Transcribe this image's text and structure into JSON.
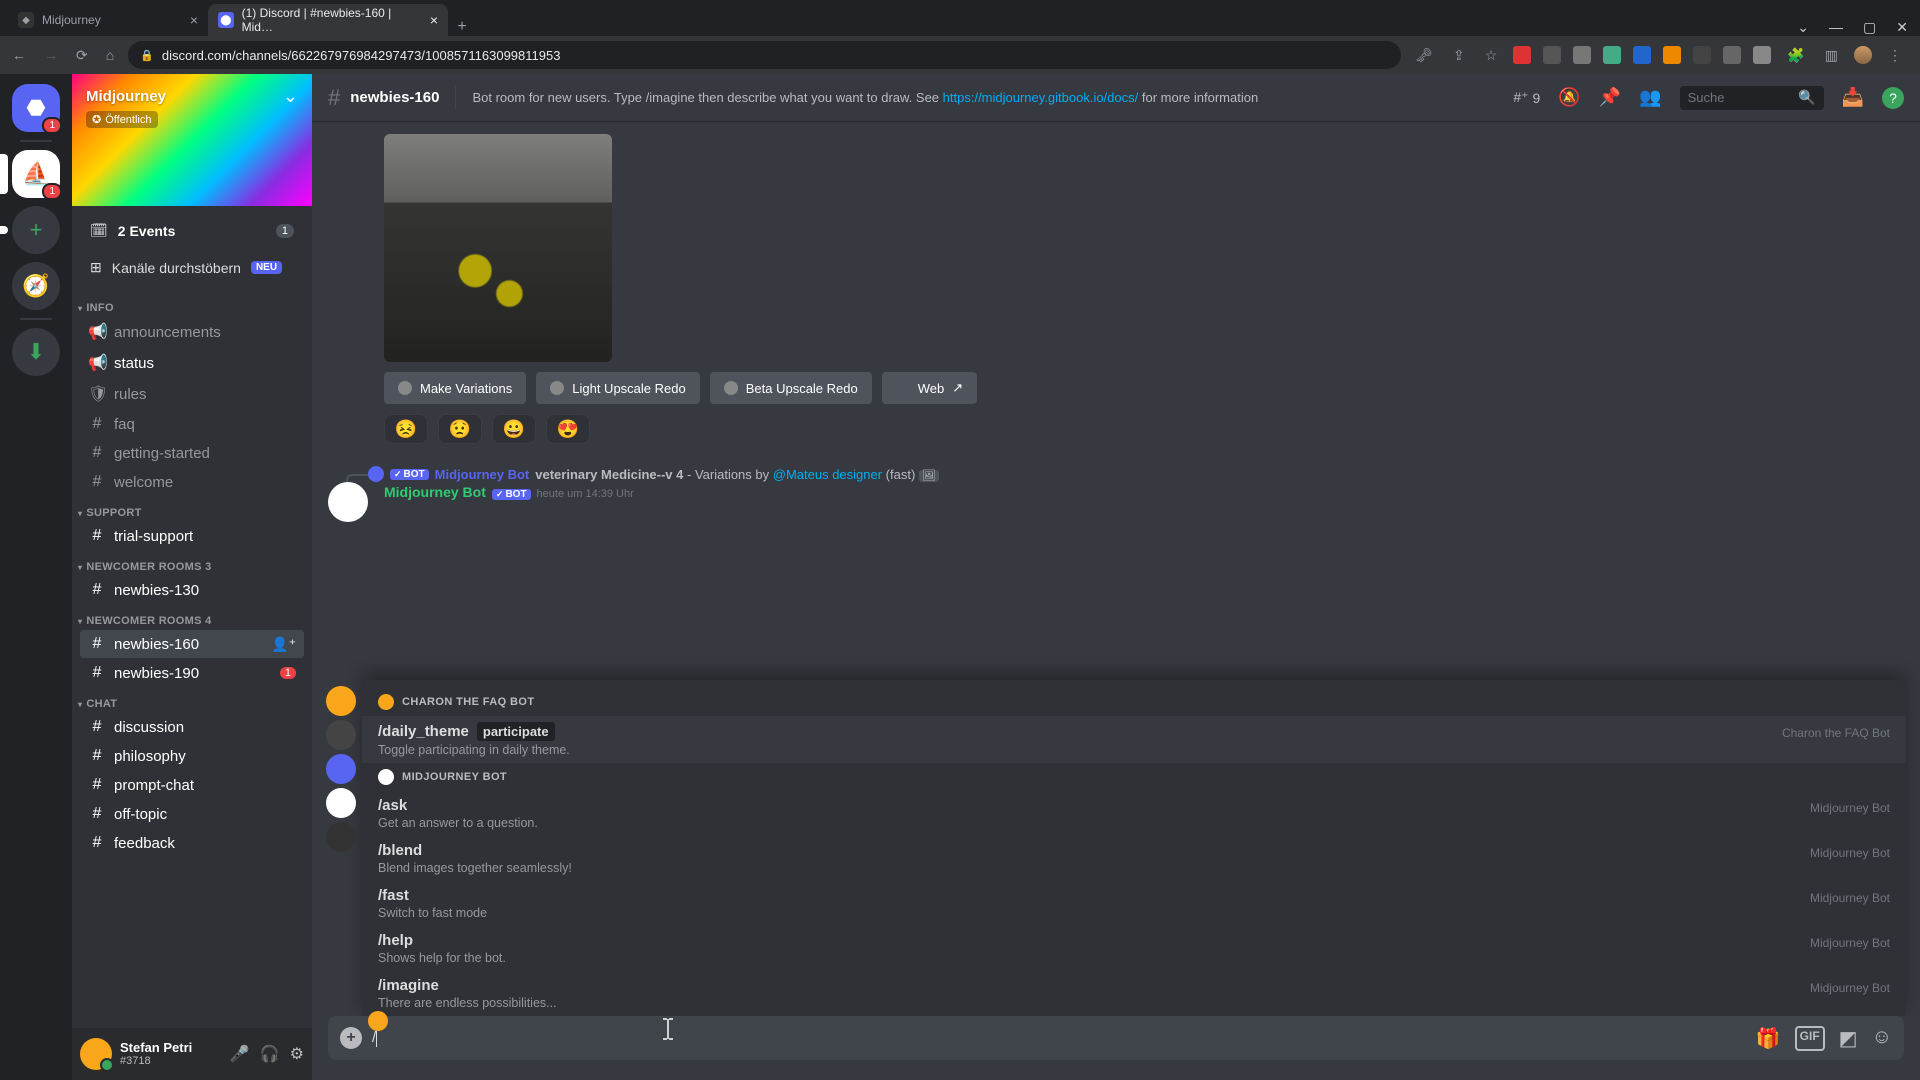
{
  "browser": {
    "tabs": [
      {
        "favicon": "M",
        "title": "Midjourney",
        "active": false
      },
      {
        "favicon": "D",
        "title": "(1) Discord | #newbies-160 | Mid…",
        "active": true
      }
    ],
    "url": "discord.com/channels/662267976984297473/1008571163099811953"
  },
  "server_rail": {
    "home_tooltip": "Home",
    "selected_server": "Midjourney",
    "add_label": "+",
    "discover_label": "🧭",
    "download_label": "⬇"
  },
  "sidebar": {
    "server_name": "Midjourney",
    "public_badge": "Öffentlich",
    "chevron": "⌄",
    "events_label": "2 Events",
    "events_count": "1",
    "browse_label": "Kanäle durchstöbern",
    "neu_badge": "NEU",
    "categories": [
      {
        "name": "INFO",
        "channels": [
          {
            "icon": "📢",
            "label": "announcements",
            "unread": false
          },
          {
            "icon": "📢",
            "label": "status",
            "unread": true
          },
          {
            "icon": "🛡",
            "label": "rules",
            "unread": false
          },
          {
            "icon": "#",
            "label": "faq",
            "unread": false
          },
          {
            "icon": "#",
            "label": "getting-started",
            "unread": false
          },
          {
            "icon": "#",
            "label": "welcome",
            "unread": false
          }
        ]
      },
      {
        "name": "SUPPORT",
        "channels": [
          {
            "icon": "#",
            "label": "trial-support",
            "unread": true
          }
        ]
      },
      {
        "name": "NEWCOMER ROOMS 3",
        "channels": [
          {
            "icon": "#",
            "label": "newbies-130",
            "unread": true
          }
        ]
      },
      {
        "name": "NEWCOMER ROOMS 4",
        "channels": [
          {
            "icon": "#",
            "label": "newbies-160",
            "unread": true,
            "selected": true,
            "invite": true
          },
          {
            "icon": "#",
            "label": "newbies-190",
            "unread": true,
            "badge": "1"
          }
        ]
      },
      {
        "name": "CHAT",
        "channels": [
          {
            "icon": "#",
            "label": "discussion",
            "unread": true
          },
          {
            "icon": "#",
            "label": "philosophy",
            "unread": true
          },
          {
            "icon": "#",
            "label": "prompt-chat",
            "unread": true
          },
          {
            "icon": "#",
            "label": "off-topic",
            "unread": true
          },
          {
            "icon": "#",
            "label": "feedback",
            "unread": true
          }
        ]
      }
    ]
  },
  "user_panel": {
    "name": "Stefan Petri",
    "tag": "#3718"
  },
  "chat": {
    "channel_name": "newbies-160",
    "topic_pre": "Bot room for new users. Type /imagine then describe what you want to draw. See ",
    "topic_link": "https://midjourney.gitbook.io/docs/",
    "topic_post": " for more information",
    "threads_count": "9",
    "search_placeholder": "Suche"
  },
  "message": {
    "action_buttons": [
      {
        "label": "Make Variations"
      },
      {
        "label": "Light Upscale Redo"
      },
      {
        "label": "Beta Upscale Redo"
      },
      {
        "label": "Web",
        "external": true
      }
    ],
    "reactions": [
      "😣",
      "😟",
      "😀",
      "😍"
    ]
  },
  "reply_preview": {
    "author": "Midjourney Bot",
    "bot_tag": "BOT",
    "content_strong": "veterinary Medicine--v 4",
    "content_mid": " - Variations by ",
    "mention": "@Mateus designer",
    "content_post": " (fast)"
  },
  "new_message_header": {
    "author": "Midjourney Bot",
    "bot_tag": "BOT",
    "timestamp": "heute um 14:39 Uhr"
  },
  "command_popup": {
    "sections": [
      {
        "title": "CHARON THE FAQ BOT",
        "icon": "charon",
        "commands": [
          {
            "name": "/daily_theme",
            "param": "participate",
            "desc": "Toggle participating in daily theme.",
            "owner": "Charon the FAQ Bot"
          }
        ]
      },
      {
        "title": "MIDJOURNEY BOT",
        "icon": "mj",
        "commands": [
          {
            "name": "/ask",
            "desc": "Get an answer to a question.",
            "owner": "Midjourney Bot"
          },
          {
            "name": "/blend",
            "desc": "Blend images together seamlessly!",
            "owner": "Midjourney Bot"
          },
          {
            "name": "/fast",
            "desc": "Switch to fast mode",
            "owner": "Midjourney Bot"
          },
          {
            "name": "/help",
            "desc": "Shows help for the bot.",
            "owner": "Midjourney Bot"
          },
          {
            "name": "/imagine",
            "desc": "There are endless possibilities...",
            "owner": "Midjourney Bot"
          }
        ]
      }
    ]
  },
  "input": {
    "typed": "/"
  }
}
